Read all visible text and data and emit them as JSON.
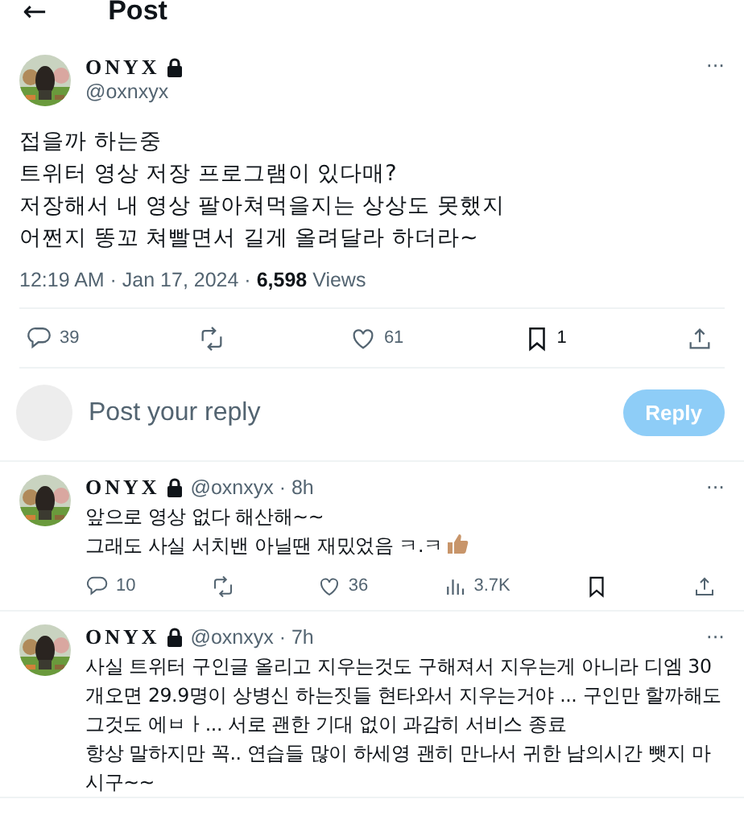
{
  "header": {
    "back": "←",
    "title": "Post"
  },
  "post": {
    "name": "ONYX",
    "locked": true,
    "handle": "@oxnxyx",
    "more": "···",
    "lines": [
      "접을까 하는중",
      "트위터 영상 저장 프로그램이 있다매?",
      "저장해서 내 영상 팔아쳐먹을지는 상상도 못했지",
      "어쩐지 똥꼬 쳐빨면서 길게 올려달라 하더라~"
    ],
    "time": "12:19 AM · Jan 17, 2024 · ",
    "views_count": "6,598",
    "views_label": " Views",
    "actions": [
      {
        "kind": "reply",
        "count": "39"
      },
      {
        "kind": "repost"
      },
      {
        "kind": "like",
        "count": "61"
      },
      {
        "kind": "bookmark",
        "count": "1"
      },
      {
        "kind": "share"
      }
    ]
  },
  "composer": {
    "placeholder": "Post your reply",
    "button": "Reply",
    "disabled": true
  },
  "replies": [
    {
      "name": "ONYX",
      "locked": true,
      "meta": "@oxnxyx · 8h",
      "more": "···",
      "lines": [
        "앞으로 영상 없다 해산해~~",
        "그래도 사실 서치밴 아닐땐 재밌었음 ㅋ.ㅋ"
      ],
      "thumbs_up": true,
      "actions": [
        {
          "kind": "reply",
          "count": "10"
        },
        {
          "kind": "repost"
        },
        {
          "kind": "like",
          "count": "36"
        },
        {
          "kind": "views",
          "count": "3.7K"
        },
        {
          "kind": "bookmark"
        },
        {
          "kind": "share"
        }
      ]
    },
    {
      "name": "ONYX",
      "locked": true,
      "meta": "@oxnxyx · 7h",
      "more": "···",
      "lines": [
        "사실 트위터 구인글 올리고 지우는것도 구해져서 지우는게 아니라 디엠 30개오면 29.9명이 상병신 하는짓들 현타와서 지우는거야 ... 구인만 할까해도 그것도 에ㅂㅏ... 서로 괜한 기대 없이 과감히 서비스 종료",
        "항상 말하지만 꼭.. 연습들 많이 하세영 괜히 만나서 귀한 남의시간 뺏지 마시구~~"
      ]
    }
  ]
}
